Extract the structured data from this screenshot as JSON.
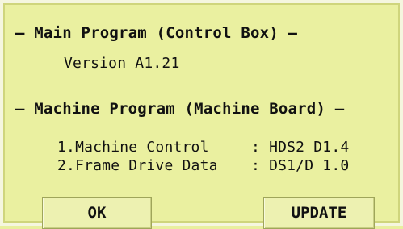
{
  "main_program": {
    "header": "— Main Program (Control Box) —",
    "version": "Version A1.21"
  },
  "machine_program": {
    "header": "— Machine Program (Machine Board) —",
    "items": [
      {
        "label": "1.Machine Control",
        "value": ": HDS2 D1.4"
      },
      {
        "label": "2.Frame Drive Data",
        "value": ": DS1/D 1.0"
      }
    ]
  },
  "buttons": {
    "ok": "OK",
    "update": "UPDATE"
  },
  "colors": {
    "background": "#eaf0a0",
    "button": "#edf1b1",
    "text": "#111111"
  }
}
